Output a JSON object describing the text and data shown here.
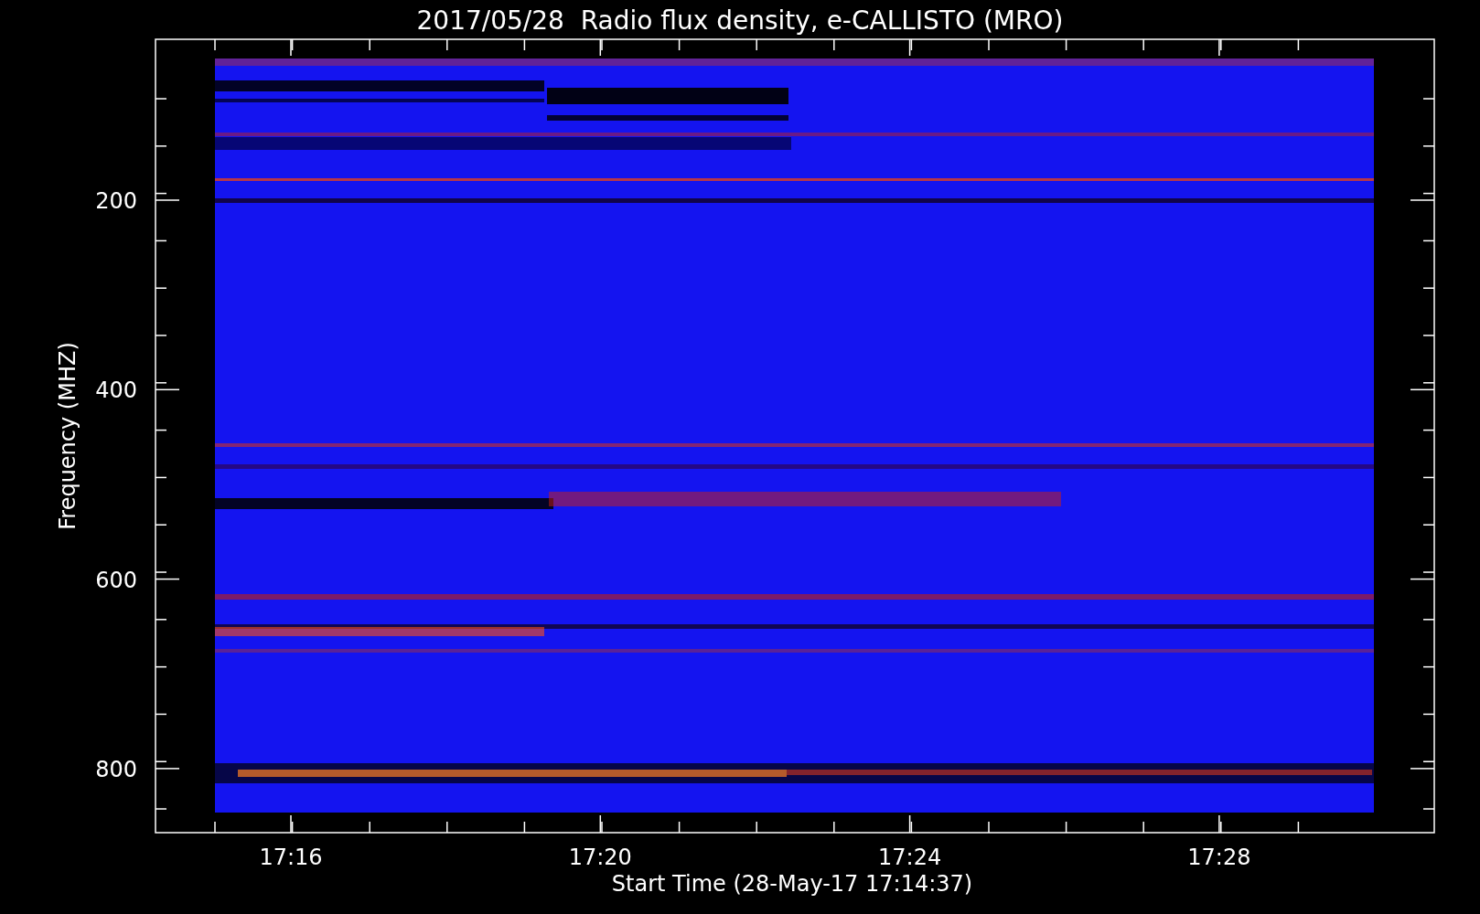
{
  "title": "2017/05/28  Radio flux density, e-CALLISTO (MRO)",
  "y_axis": {
    "label": "Frequency (MHZ)",
    "ticks": [
      "200",
      "400",
      "600",
      "800"
    ]
  },
  "x_axis": {
    "label": "Start Time (28-May-17 17:14:37)",
    "ticks": [
      "17:16",
      "17:20",
      "17:24",
      "17:28"
    ]
  }
}
